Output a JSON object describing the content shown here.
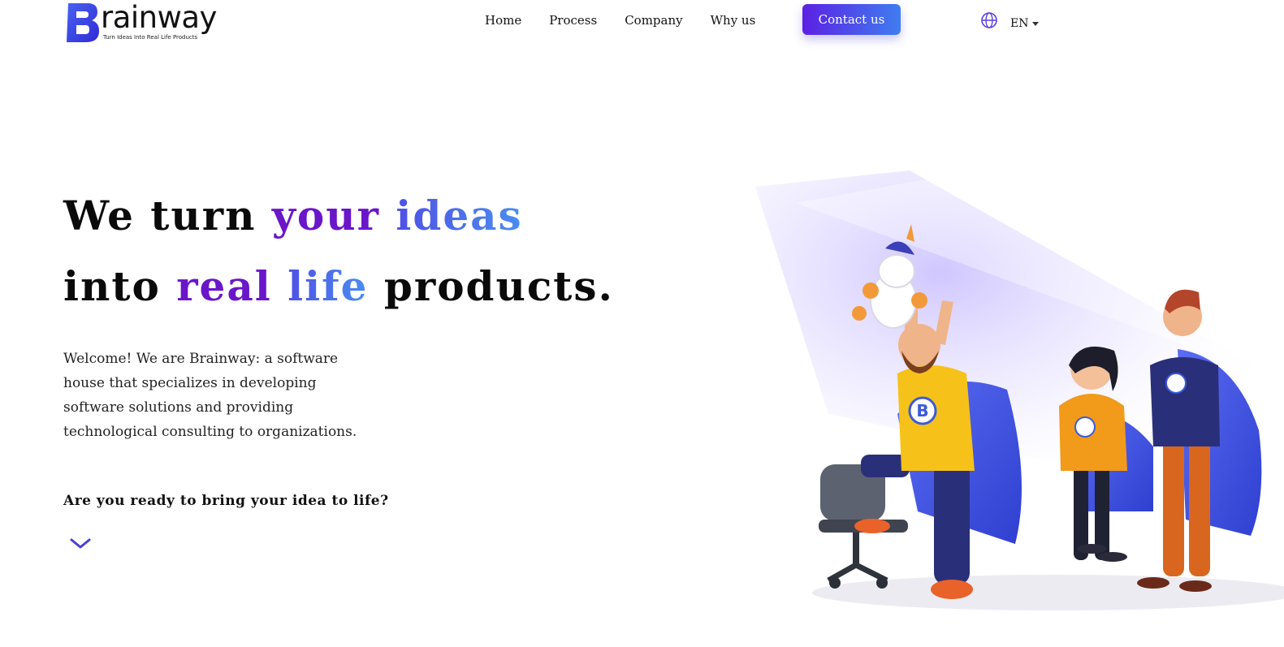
{
  "header": {
    "logo_word": "rainway",
    "logo_letter": "B",
    "logo_tagline": "Turn Ideas Into Real Life Products",
    "nav": [
      {
        "label": "Home"
      },
      {
        "label": "Process"
      },
      {
        "label": "Company"
      },
      {
        "label": "Why us"
      }
    ],
    "contact_label": "Contact us",
    "language": "EN",
    "language_icon": "globe-icon"
  },
  "hero": {
    "line1": {
      "plain": "We turn ",
      "accent1": "your",
      "space": " ",
      "accent2": "ideas"
    },
    "line2": {
      "plain": "into ",
      "accent1": "real",
      "space": " ",
      "accent2": "life",
      "tail": " products."
    },
    "intro": "Welcome! We are Brainway: a software house that specializes in developing software solutions and providing technological consulting to organizations.",
    "question": "Are you ready to bring your idea to life?",
    "scroll_icon": "chevron-down-icon",
    "mascot_letter": "B"
  },
  "colors": {
    "accent_purple": "#6a16c9",
    "accent_blue": "#4a8ef0",
    "button_gradient_start": "#5b21e3",
    "button_gradient_end": "#3f7df0"
  }
}
